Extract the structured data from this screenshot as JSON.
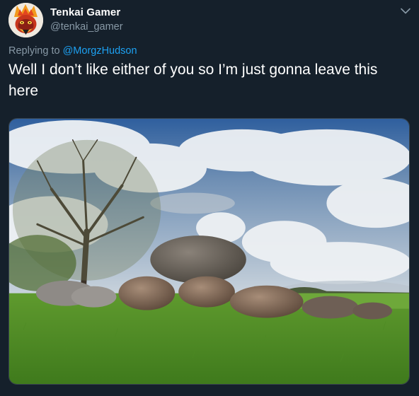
{
  "tweet": {
    "author": {
      "display_name": "Tenkai Gamer",
      "handle": "@tenkai_gamer",
      "avatar_icon": "cartoon-avatar"
    },
    "menu_icon": "chevron-down-icon",
    "reply_context": {
      "prefix": "Replying to ",
      "mention": "@MorgzHudson"
    },
    "text": "Well I don’t like either of you so I’m just gonna leave this here",
    "media": {
      "type": "photo"
    }
  },
  "colors": {
    "background": "#15202b",
    "primary_text": "#ffffff",
    "secondary_text": "#8899a6",
    "link": "#1da1f2"
  }
}
